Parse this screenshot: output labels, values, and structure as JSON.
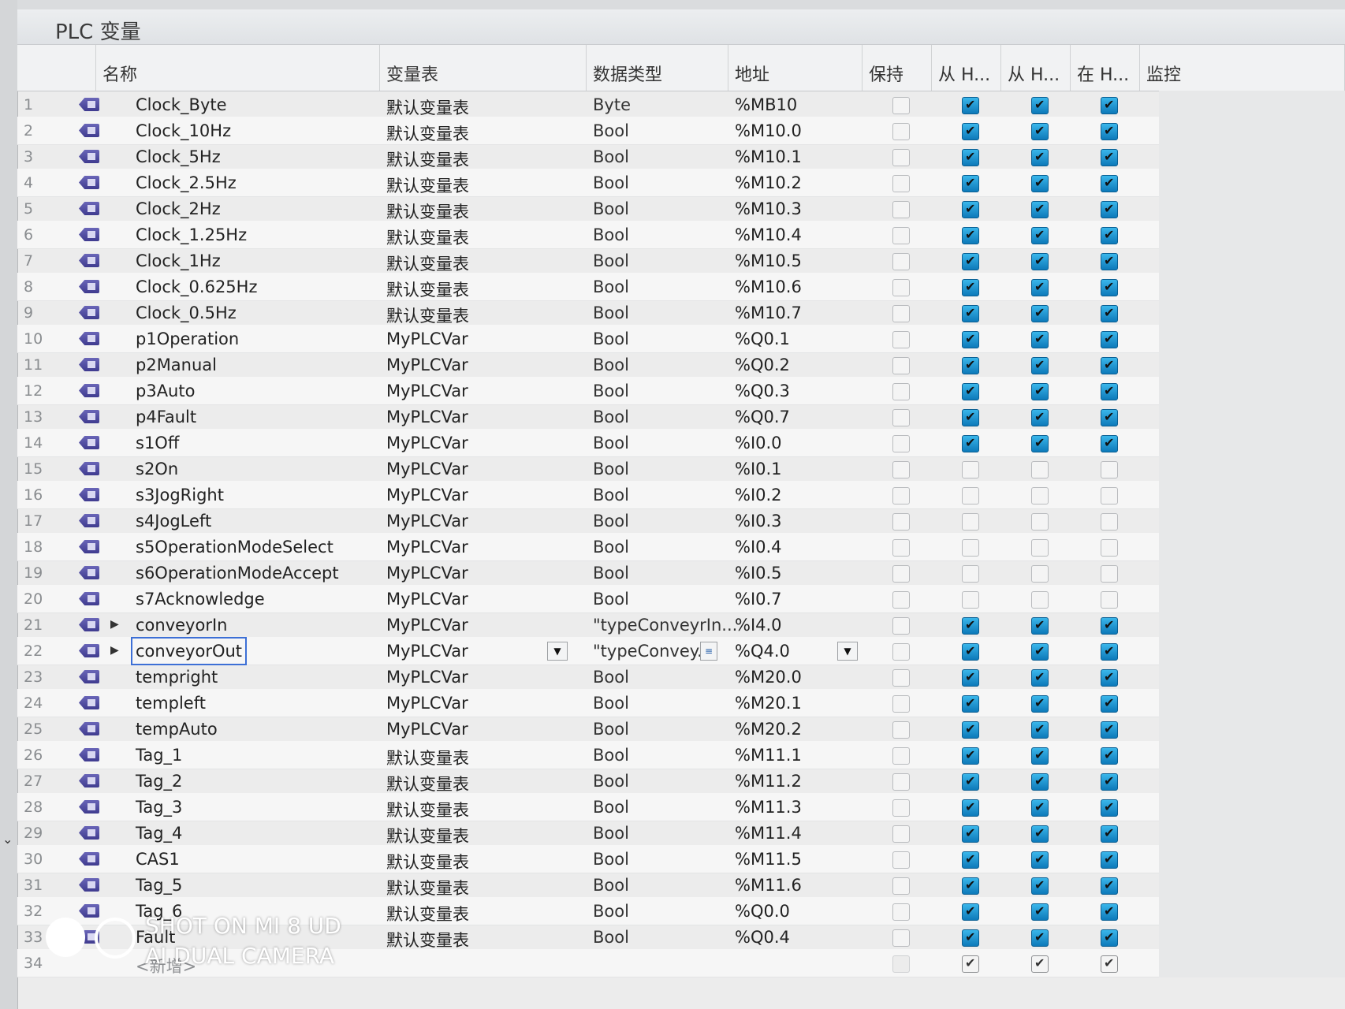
{
  "title": "PLC 变量",
  "columns": {
    "name": "名称",
    "table": "变量表",
    "data_type": "数据类型",
    "address": "地址",
    "retain": "保持",
    "access_hmi": "从 H...",
    "write_hmi": "从 H...",
    "visible_hmi": "在 H...",
    "monitor": "监控"
  },
  "rows": [
    {
      "num": "1",
      "name": "Clock_Byte",
      "table": "默认变量表",
      "type": "Byte",
      "addr": "%MB10",
      "c1": "on",
      "c2": "on",
      "c3": "on"
    },
    {
      "num": "2",
      "name": "Clock_10Hz",
      "table": "默认变量表",
      "type": "Bool",
      "addr": "%M10.0",
      "c1": "on",
      "c2": "on",
      "c3": "on"
    },
    {
      "num": "3",
      "name": "Clock_5Hz",
      "table": "默认变量表",
      "type": "Bool",
      "addr": "%M10.1",
      "c1": "on",
      "c2": "on",
      "c3": "on"
    },
    {
      "num": "4",
      "name": "Clock_2.5Hz",
      "table": "默认变量表",
      "type": "Bool",
      "addr": "%M10.2",
      "c1": "on",
      "c2": "on",
      "c3": "on"
    },
    {
      "num": "5",
      "name": "Clock_2Hz",
      "table": "默认变量表",
      "type": "Bool",
      "addr": "%M10.3",
      "c1": "on",
      "c2": "on",
      "c3": "on"
    },
    {
      "num": "6",
      "name": "Clock_1.25Hz",
      "table": "默认变量表",
      "type": "Bool",
      "addr": "%M10.4",
      "c1": "on",
      "c2": "on",
      "c3": "on"
    },
    {
      "num": "7",
      "name": "Clock_1Hz",
      "table": "默认变量表",
      "type": "Bool",
      "addr": "%M10.5",
      "c1": "on",
      "c2": "on",
      "c3": "on"
    },
    {
      "num": "8",
      "name": "Clock_0.625Hz",
      "table": "默认变量表",
      "type": "Bool",
      "addr": "%M10.6",
      "c1": "on",
      "c2": "on",
      "c3": "on"
    },
    {
      "num": "9",
      "name": "Clock_0.5Hz",
      "table": "默认变量表",
      "type": "Bool",
      "addr": "%M10.7",
      "c1": "on",
      "c2": "on",
      "c3": "on"
    },
    {
      "num": "10",
      "name": "p1Operation",
      "table": "MyPLCVar",
      "type": "Bool",
      "addr": "%Q0.1",
      "c1": "on",
      "c2": "on",
      "c3": "on"
    },
    {
      "num": "11",
      "name": "p2Manual",
      "table": "MyPLCVar",
      "type": "Bool",
      "addr": "%Q0.2",
      "c1": "on",
      "c2": "on",
      "c3": "on"
    },
    {
      "num": "12",
      "name": "p3Auto",
      "table": "MyPLCVar",
      "type": "Bool",
      "addr": "%Q0.3",
      "c1": "on",
      "c2": "on",
      "c3": "on"
    },
    {
      "num": "13",
      "name": "p4Fault",
      "table": "MyPLCVar",
      "type": "Bool",
      "addr": "%Q0.7",
      "c1": "on",
      "c2": "on",
      "c3": "on"
    },
    {
      "num": "14",
      "name": "s1Off",
      "table": "MyPLCVar",
      "type": "Bool",
      "addr": "%I0.0",
      "c1": "on",
      "c2": "on",
      "c3": "on"
    },
    {
      "num": "15",
      "name": "s2On",
      "table": "MyPLCVar",
      "type": "Bool",
      "addr": "%I0.1",
      "c1": "off",
      "c2": "off",
      "c3": "off"
    },
    {
      "num": "16",
      "name": "s3JogRight",
      "table": "MyPLCVar",
      "type": "Bool",
      "addr": "%I0.2",
      "c1": "off",
      "c2": "off",
      "c3": "off"
    },
    {
      "num": "17",
      "name": "s4JogLeft",
      "table": "MyPLCVar",
      "type": "Bool",
      "addr": "%I0.3",
      "c1": "off",
      "c2": "off",
      "c3": "off"
    },
    {
      "num": "18",
      "name": "s5OperationModeSelect",
      "table": "MyPLCVar",
      "type": "Bool",
      "addr": "%I0.4",
      "c1": "off",
      "c2": "off",
      "c3": "off"
    },
    {
      "num": "19",
      "name": "s6OperationModeAccept",
      "table": "MyPLCVar",
      "type": "Bool",
      "addr": "%I0.5",
      "c1": "off",
      "c2": "off",
      "c3": "off"
    },
    {
      "num": "20",
      "name": "s7Acknowledge",
      "table": "MyPLCVar",
      "type": "Bool",
      "addr": "%I0.7",
      "c1": "off",
      "c2": "off",
      "c3": "off"
    },
    {
      "num": "21",
      "name": "conveyorIn",
      "table": "MyPLCVar",
      "type": "\"typeConveyrIn...",
      "addr": "%I4.0",
      "c1": "on",
      "c2": "on",
      "c3": "on",
      "expand": "▶"
    },
    {
      "num": "22",
      "name": "conveyorOut",
      "table": "MyPLCVar",
      "type": "\"typeConvey...",
      "addr": "%Q4.0",
      "c1": "on",
      "c2": "on",
      "c3": "on",
      "expand": "▶",
      "selected": true
    },
    {
      "num": "23",
      "name": "tempright",
      "table": "MyPLCVar",
      "type": "Bool",
      "addr": "%M20.0",
      "c1": "on",
      "c2": "on",
      "c3": "on"
    },
    {
      "num": "24",
      "name": "templeft",
      "table": "MyPLCVar",
      "type": "Bool",
      "addr": "%M20.1",
      "c1": "on",
      "c2": "on",
      "c3": "on"
    },
    {
      "num": "25",
      "name": "tempAuto",
      "table": "MyPLCVar",
      "type": "Bool",
      "addr": "%M20.2",
      "c1": "on",
      "c2": "on",
      "c3": "on"
    },
    {
      "num": "26",
      "name": "Tag_1",
      "table": "默认变量表",
      "type": "Bool",
      "addr": "%M11.1",
      "c1": "on",
      "c2": "on",
      "c3": "on"
    },
    {
      "num": "27",
      "name": "Tag_2",
      "table": "默认变量表",
      "type": "Bool",
      "addr": "%M11.2",
      "c1": "on",
      "c2": "on",
      "c3": "on"
    },
    {
      "num": "28",
      "name": "Tag_3",
      "table": "默认变量表",
      "type": "Bool",
      "addr": "%M11.3",
      "c1": "on",
      "c2": "on",
      "c3": "on"
    },
    {
      "num": "29",
      "name": "Tag_4",
      "table": "默认变量表",
      "type": "Bool",
      "addr": "%M11.4",
      "c1": "on",
      "c2": "on",
      "c3": "on"
    },
    {
      "num": "30",
      "name": "CAS1",
      "table": "默认变量表",
      "type": "Bool",
      "addr": "%M11.5",
      "c1": "on",
      "c2": "on",
      "c3": "on"
    },
    {
      "num": "31",
      "name": "Tag_5",
      "table": "默认变量表",
      "type": "Bool",
      "addr": "%M11.6",
      "c1": "on",
      "c2": "on",
      "c3": "on"
    },
    {
      "num": "32",
      "name": "Tag_6",
      "table": "默认变量表",
      "type": "Bool",
      "addr": "%Q0.0",
      "c1": "on",
      "c2": "on",
      "c3": "on"
    },
    {
      "num": "33",
      "name": "Fault",
      "table": "默认变量表",
      "type": "Bool",
      "addr": "%Q0.4",
      "c1": "on",
      "c2": "on",
      "c3": "on"
    },
    {
      "num": "34",
      "name": "<新增>",
      "table": "",
      "type": "",
      "addr": "",
      "c1": "plain-on",
      "c2": "plain-on",
      "c3": "plain-on",
      "placeholder": true
    }
  ],
  "watermark": {
    "line1": "SHOT ON MI 8 UD",
    "line2": "AI DUAL CAMERA"
  }
}
